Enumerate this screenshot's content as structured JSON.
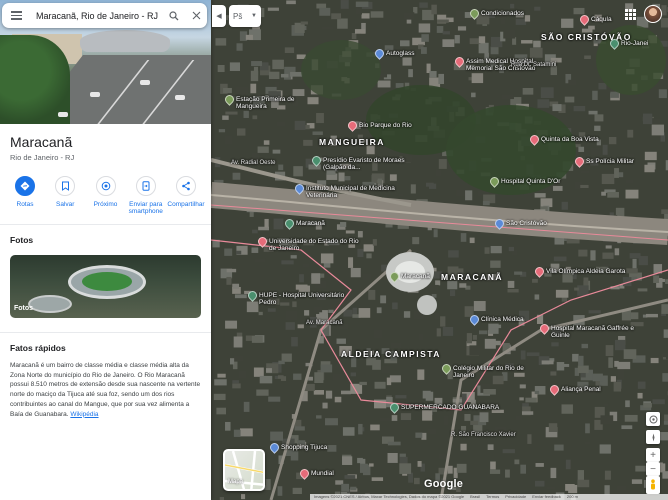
{
  "search": {
    "query": "Maracanã, Rio de Janeiro - RJ"
  },
  "layer_chip": {
    "label": "Pš"
  },
  "place": {
    "title": "Maracanã",
    "subtitle": "Rio de Janeiro - RJ"
  },
  "actions": [
    {
      "label": "Rotas",
      "icon": "directions-icon"
    },
    {
      "label": "Salvar",
      "icon": "bookmark-icon"
    },
    {
      "label": "Próximo",
      "icon": "nearby-icon"
    },
    {
      "label": "Enviar para smartphone",
      "icon": "send-to-phone-icon"
    },
    {
      "label": "Compartilhar",
      "icon": "share-icon"
    }
  ],
  "photos": {
    "heading": "Fotos",
    "overlay_label": "Fotos"
  },
  "facts": {
    "heading": "Fatos rápidos",
    "text": "Maracanã é um bairro de classe média e classe média alta da Zona Norte do município do Rio de Janeiro. O Rio Maracanã possui 8.510 metros de extensão desde sua nascente na vertente norte do maciço da Tijuca até sua foz, sendo um dos rios contribuintes ao canal do Mangue, que por sua vez alimenta a Baía de Guanabara.",
    "link": "Wikipédia"
  },
  "map": {
    "labels": [
      {
        "text": "SÃO CRISTÓVÃO",
        "kind": "big"
      },
      {
        "text": "MARACANÃ",
        "kind": "big"
      },
      {
        "text": "MANGUEIRA",
        "kind": "big"
      },
      {
        "text": "ALDEIA CAMPISTA",
        "kind": "big"
      },
      {
        "text": "Condicionados",
        "kind": "poi"
      },
      {
        "text": "Cáqula",
        "kind": "poi"
      },
      {
        "text": "Rio-Janei",
        "kind": "poi"
      },
      {
        "text": "Autoglass",
        "kind": "poi"
      },
      {
        "text": "Assim Medical Hospital Memorial São Cristóvão",
        "kind": "poi"
      },
      {
        "text": "Estação Primeira de Mangueira",
        "kind": "poi"
      },
      {
        "text": "Bio Parque do Rio",
        "kind": "poi"
      },
      {
        "text": "Presídio Evaristo de Moraes (Galpão da...",
        "kind": "poi"
      },
      {
        "text": "Instituto Municipal de Medicina Veterinária",
        "kind": "poi"
      },
      {
        "text": "Quinta da Boa Vista",
        "kind": "poi"
      },
      {
        "text": "Hospital Quinta D'Or",
        "kind": "poi"
      },
      {
        "text": "Ss Polícia Militar",
        "kind": "poi"
      },
      {
        "text": "Maracanã",
        "kind": "poi"
      },
      {
        "text": "São Cristóvão",
        "kind": "poi"
      },
      {
        "text": "Universidade do Estado do Rio de Janeiro",
        "kind": "poi"
      },
      {
        "text": "Maracanã",
        "kind": "poi"
      },
      {
        "text": "Vila Olímpica Aldeia Garota",
        "kind": "poi"
      },
      {
        "text": "HUPE - Hospital Universitário Pedro",
        "kind": "poi"
      },
      {
        "text": "Clínica Médica",
        "kind": "poi"
      },
      {
        "text": "Hospital Maracanã Gaffrée e Guinle",
        "kind": "poi"
      },
      {
        "text": "Colégio Militar do Rio de Janeiro",
        "kind": "poi"
      },
      {
        "text": "Aliança Penal",
        "kind": "poi"
      },
      {
        "text": "SUPERMERCADO GUANABARA",
        "kind": "poi"
      },
      {
        "text": "Shopping Tijuca",
        "kind": "poi"
      },
      {
        "text": "Mundial",
        "kind": "poi"
      },
      {
        "text": "Av. Maracanã",
        "kind": "road"
      },
      {
        "text": "R. São Francisco Xavier",
        "kind": "road"
      },
      {
        "text": "Av. Radial Oeste",
        "kind": "road"
      },
      {
        "text": "Rua Dr. Satamini",
        "kind": "road"
      }
    ],
    "minimap_label": "Mapa",
    "brand": "Google",
    "attribution": [
      "Imagens ©2021 CNES / Airbus, Maxar Technologies, Dados do mapa ©2021 Google",
      "Brasil",
      "Termos",
      "Privacidade",
      "Enviar feedback",
      "200 m"
    ]
  }
}
